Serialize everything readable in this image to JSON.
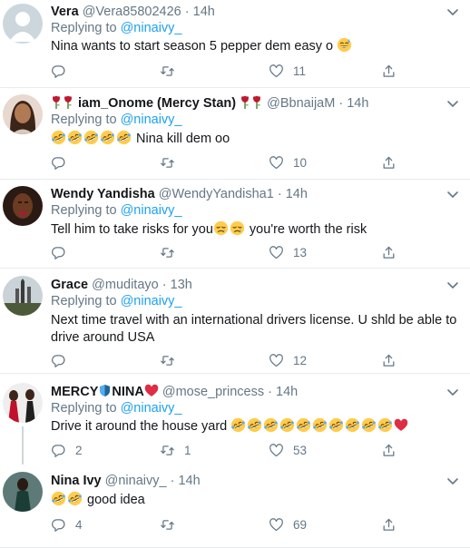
{
  "colors": {
    "accent": "#1da1f2",
    "muted": "#657786",
    "text": "#14171a",
    "divider": "#e6ecf0",
    "heart": "#dd2e44"
  },
  "tweets": [
    {
      "name": "Vera",
      "handle": "@Vera85802426",
      "dot": "·",
      "time": "14h",
      "replying_prefix": "Replying to",
      "replying_to": "@ninaivy_",
      "text": "Nina wants to start season 5 pepper dem easy o",
      "emoji_after": "grinning-sweat-emoji",
      "replies": "",
      "retweets": "",
      "likes": "11"
    },
    {
      "name": "iam_Onome (Mercy Stan)",
      "handle": "@BbnaijaM",
      "dot": "·",
      "time": "14h",
      "replying_prefix": "Replying to",
      "replying_to": "@ninaivy_",
      "emoji_prefix": "rofl-emoji x5",
      "text": "Nina kill dem oo",
      "replies": "",
      "retweets": "",
      "likes": "10"
    },
    {
      "name": "Wendy Yandisha",
      "handle": "@WendyYandisha1",
      "dot": "·",
      "time": "14h",
      "replying_prefix": "Replying to",
      "replying_to": "@ninaivy_",
      "text_a": "Tell him to take risks for you",
      "text_b": " you're worth the risk",
      "replies": "",
      "retweets": "",
      "likes": "13"
    },
    {
      "name": "Grace",
      "handle": "@muditayo",
      "dot": "·",
      "time": "13h",
      "replying_prefix": "Replying to",
      "replying_to": "@ninaivy_",
      "text": "Next time travel with an international drivers license. U shld be able to drive around USA",
      "replies": "",
      "retweets": "",
      "likes": "12"
    },
    {
      "name_a": "MERCY",
      "name_b": "NINA",
      "handle": "@mose_princess",
      "dot": "·",
      "time": "14h",
      "replying_prefix": "Replying to",
      "replying_to": "@ninaivy_",
      "text": "Drive it around the house yard",
      "emoji_after": "rofl-emoji x10, red-heart-emoji",
      "replies": "2",
      "retweets": "1",
      "likes": "53"
    },
    {
      "name": "Nina Ivy",
      "handle": "@ninaivy_",
      "dot": "·",
      "time": "14h",
      "emoji_prefix": "rofl-emoji x2",
      "text": "good idea",
      "replies": "4",
      "retweets": "",
      "likes": "69"
    }
  ]
}
